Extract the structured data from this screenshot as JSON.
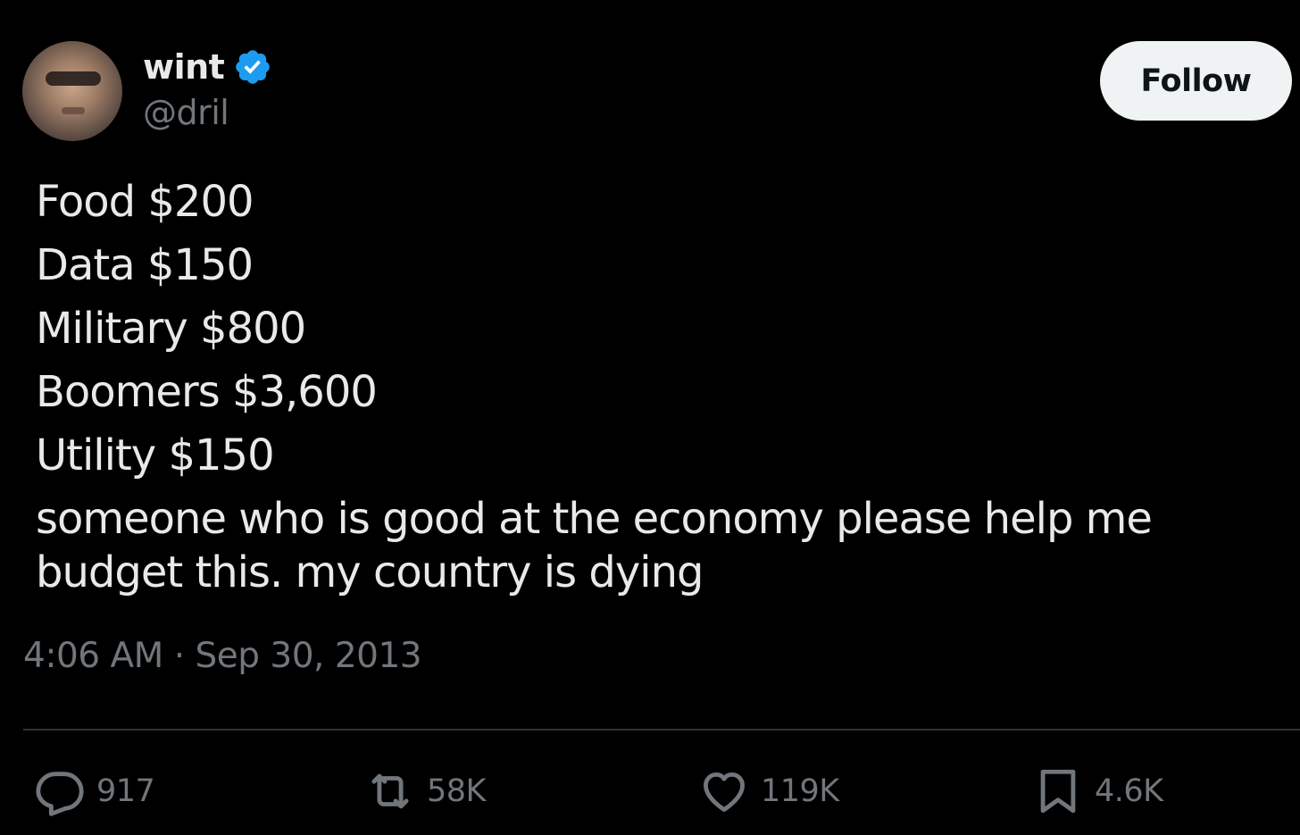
{
  "author": {
    "display_name": "wint",
    "handle": "@dril",
    "verified": true
  },
  "follow_button": {
    "label": "Follow"
  },
  "tweet": {
    "lines": [
      "Food $200",
      "Data $150",
      "Military $800",
      "Boomers $3,600",
      "Utility $150",
      "someone who is good at the economy please help me",
      "budget this. my country is dying"
    ],
    "timestamp": "4:06 AM · Sep 30, 2013"
  },
  "actions": {
    "replies": "917",
    "reposts": "58K",
    "likes": "119K",
    "bookmarks": "4.6K"
  },
  "colors": {
    "background": "#000000",
    "text": "#e7e9ea",
    "muted": "#71767b",
    "verified_badge": "#1d9bf0",
    "follow_bg": "#eff3f4",
    "divider": "#2f3336"
  },
  "icons": {
    "avatar": "profile-photo",
    "verified": "verified-badge-icon",
    "reply": "reply-icon",
    "repost": "repost-icon",
    "like": "heart-icon",
    "bookmark": "bookmark-icon"
  }
}
